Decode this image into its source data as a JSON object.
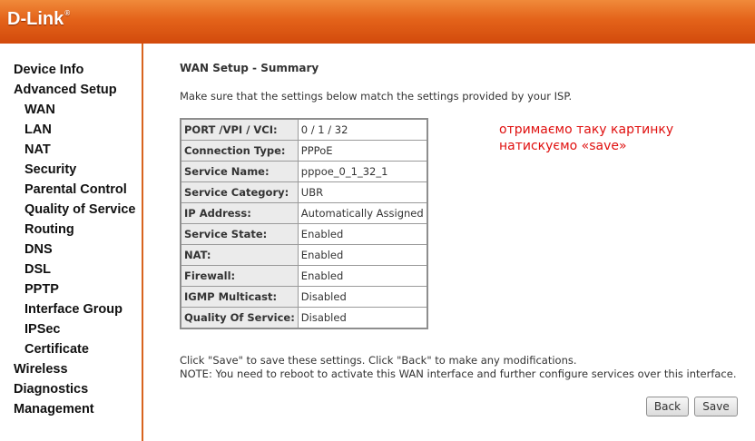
{
  "header": {
    "logo": "D-Link",
    "logo_mark": "®"
  },
  "sidebar": {
    "items": [
      {
        "label": "Device Info"
      },
      {
        "label": "Advanced Setup"
      },
      {
        "label": "WAN"
      },
      {
        "label": "LAN"
      },
      {
        "label": "NAT"
      },
      {
        "label": "Security"
      },
      {
        "label": "Parental Control"
      },
      {
        "label": "Quality of Service"
      },
      {
        "label": "Routing"
      },
      {
        "label": "DNS"
      },
      {
        "label": "DSL"
      },
      {
        "label": "PPTP"
      },
      {
        "label": "Interface Group"
      },
      {
        "label": "IPSec"
      },
      {
        "label": "Certificate"
      },
      {
        "label": "Wireless"
      },
      {
        "label": "Diagnostics"
      },
      {
        "label": "Management"
      }
    ]
  },
  "main": {
    "title": "WAN Setup - Summary",
    "intro": "Make sure that the settings below match the settings provided by your ISP.",
    "rows": [
      {
        "label": "PORT /VPI / VCI:",
        "value": "0 / 1 / 32"
      },
      {
        "label": "Connection Type:",
        "value": "PPPoE"
      },
      {
        "label": "Service Name:",
        "value": "pppoe_0_1_32_1"
      },
      {
        "label": "Service Category:",
        "value": "UBR"
      },
      {
        "label": "IP Address:",
        "value": "Automatically Assigned"
      },
      {
        "label": "Service State:",
        "value": "Enabled"
      },
      {
        "label": "NAT:",
        "value": "Enabled"
      },
      {
        "label": "Firewall:",
        "value": "Enabled"
      },
      {
        "label": "IGMP Multicast:",
        "value": "Disabled"
      },
      {
        "label": "Quality Of Service:",
        "value": "Disabled"
      }
    ],
    "note1": "Click \"Save\" to save these settings. Click \"Back\" to make any modifications.",
    "note2": "NOTE: You need to reboot to activate this WAN interface and further configure services over this interface.",
    "back_label": "Back",
    "save_label": "Save"
  },
  "annotation": {
    "line1": "отримаємо таку картинку",
    "line2": "натискуємо «save»"
  },
  "colors": {
    "header": "#e4631a",
    "annotation": "#e0100f"
  }
}
